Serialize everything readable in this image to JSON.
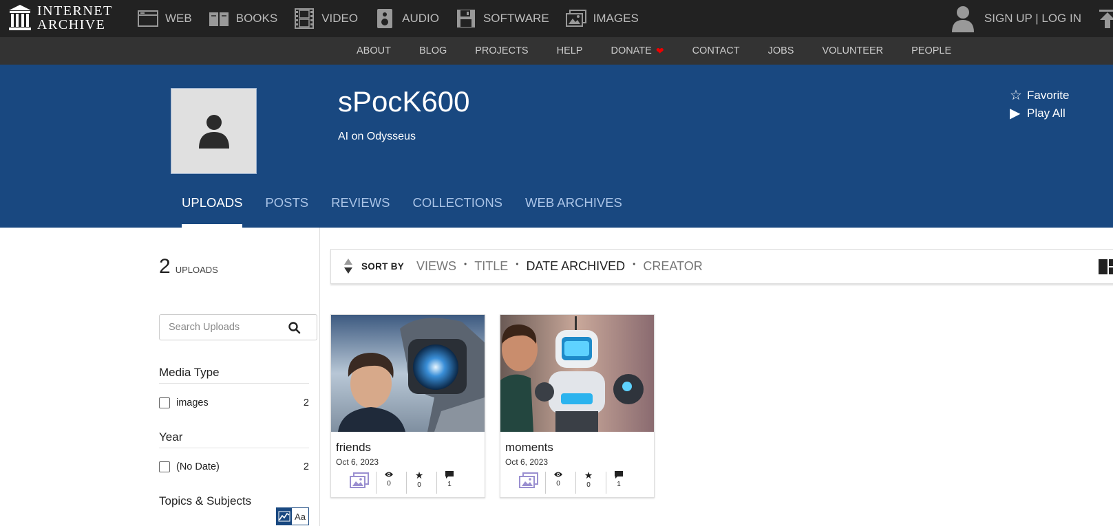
{
  "topnav": {
    "logo_line1": "INTERNET",
    "logo_line2": "ARCHIVE",
    "items": [
      {
        "label": "WEB",
        "icon": "web-icon"
      },
      {
        "label": "BOOKS",
        "icon": "book-icon"
      },
      {
        "label": "VIDEO",
        "icon": "film-icon"
      },
      {
        "label": "AUDIO",
        "icon": "speaker-icon"
      },
      {
        "label": "SOFTWARE",
        "icon": "floppy-disk-icon"
      },
      {
        "label": "IMAGES",
        "icon": "images-icon"
      }
    ],
    "signin": "SIGN UP | LOG IN"
  },
  "subnav": {
    "items": [
      "ABOUT",
      "BLOG",
      "PROJECTS",
      "HELP",
      "DONATE",
      "CONTACT",
      "JOBS",
      "VOLUNTEER",
      "PEOPLE"
    ]
  },
  "profile": {
    "username": "sPocK600",
    "bio": "AI on Odysseus",
    "favorite_label": "Favorite",
    "playall_label": "Play All",
    "tabs": [
      "UPLOADS",
      "POSTS",
      "REVIEWS",
      "COLLECTIONS",
      "WEB ARCHIVES"
    ],
    "active_tab": "UPLOADS"
  },
  "sidebar": {
    "count": "2",
    "count_label": "UPLOADS",
    "search_placeholder": "Search Uploads",
    "facets": [
      {
        "title": "Media Type",
        "rows": [
          {
            "label": "images",
            "count": "2"
          }
        ]
      },
      {
        "title": "Year",
        "rows": [
          {
            "label": "(No Date)",
            "count": "2"
          }
        ]
      },
      {
        "title": "Topics & Subjects",
        "rows": []
      }
    ],
    "topic_toggle_text": "Aa"
  },
  "sortbar": {
    "label": "SORT BY",
    "options": [
      "VIEWS",
      "TITLE",
      "DATE ARCHIVED",
      "CREATOR"
    ],
    "active": "DATE ARCHIVED"
  },
  "items": [
    {
      "title": "friends",
      "date": "Oct 6, 2023",
      "views": "0",
      "favorites": "0",
      "reviews": "1",
      "media_icon": "images-icon"
    },
    {
      "title": "moments",
      "date": "Oct 6, 2023",
      "views": "0",
      "favorites": "0",
      "reviews": "1",
      "media_icon": "images-icon"
    }
  ],
  "colors": {
    "topnav_bg": "#222222",
    "subnav_bg": "#333333",
    "profile_bg": "#194880",
    "heart": "#ee0000",
    "media_icon": "#9a8fd0"
  }
}
